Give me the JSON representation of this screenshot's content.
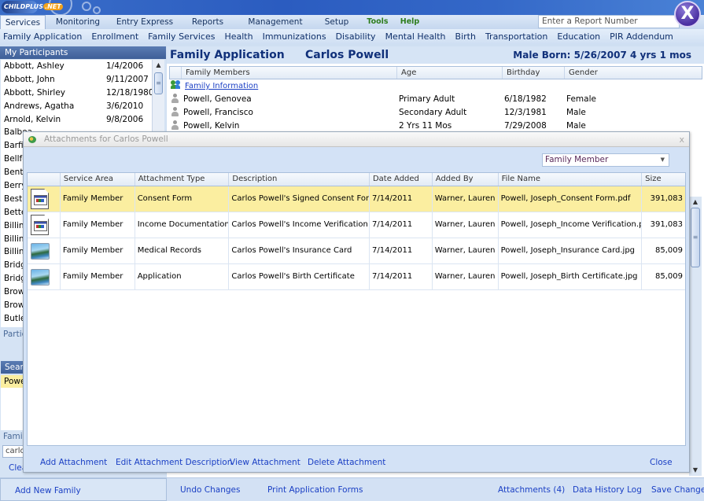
{
  "app": {
    "logo_text": "CHILDPLUS",
    "logo_badge": ".NET",
    "close_label": "X"
  },
  "main_menu": [
    {
      "label": "Services",
      "active": true
    },
    {
      "label": "Monitoring"
    },
    {
      "label": "Entry Express"
    },
    {
      "label": "Reports"
    },
    {
      "label": "Management"
    },
    {
      "label": "Setup"
    },
    {
      "label": "Tools",
      "style": "green"
    },
    {
      "label": "Help",
      "style": "green"
    }
  ],
  "report_search": {
    "placeholder": "Enter a Report Number"
  },
  "sub_menu": [
    "Family Application",
    "Enrollment",
    "Family Services",
    "Health",
    "Immunizations",
    "Disability",
    "Mental Health",
    "Birth",
    "Transportation",
    "Education",
    "PIR Addendum"
  ],
  "left_panel": {
    "title": "My Participants",
    "participants": [
      {
        "name": "Abbott, Ashley",
        "date": "1/4/2006"
      },
      {
        "name": "Abbott, John",
        "date": "9/11/2007"
      },
      {
        "name": "Abbott, Shirley",
        "date": "12/18/1980"
      },
      {
        "name": "Andrews, Agatha",
        "date": "3/6/2010"
      },
      {
        "name": "Arnold, Kelvin",
        "date": "9/8/2006"
      },
      {
        "name": "Balboa",
        "date": ""
      },
      {
        "name": "Barfield",
        "date": ""
      },
      {
        "name": "Bellford",
        "date": ""
      },
      {
        "name": "Bentley",
        "date": ""
      },
      {
        "name": "Berry,",
        "date": ""
      },
      {
        "name": "Best,",
        "date": ""
      },
      {
        "name": "Better",
        "date": ""
      },
      {
        "name": "Billings",
        "date": ""
      },
      {
        "name": "Billings",
        "date": ""
      },
      {
        "name": "Billings",
        "date": ""
      },
      {
        "name": "Bridge",
        "date": ""
      },
      {
        "name": "Bridge",
        "date": ""
      },
      {
        "name": "Brown",
        "date": ""
      },
      {
        "name": "Brown",
        "date": ""
      },
      {
        "name": "Butler",
        "date": ""
      }
    ],
    "participants_label": "Partic",
    "search_title": "Search",
    "search_result": "Powell",
    "family_label": "Family",
    "family_input_value": "carlos",
    "clear_label": "Clear"
  },
  "content": {
    "section_title": "Family Application",
    "child_name": "Carlos Powell",
    "child_info": "Male  Born: 5/26/2007  4 yrs 1 mos",
    "family_grid": {
      "columns": [
        "Family Members",
        "Age",
        "Birthday",
        "Gender"
      ],
      "family_info_link": "Family Information",
      "rows": [
        {
          "name": "Powell, Genovea",
          "age": "Primary Adult",
          "birthday": "6/18/1982",
          "gender": "Female"
        },
        {
          "name": "Powell, Francisco",
          "age": "Secondary Adult",
          "birthday": "12/3/1981",
          "gender": "Male"
        },
        {
          "name": "Powell, Kelvin",
          "age": "2 Yrs 11 Mos",
          "birthday": "7/29/2008",
          "gender": "Male"
        }
      ]
    }
  },
  "dialog": {
    "title": "Attachments for Carlos Powell",
    "close_label": "x",
    "filter_value": "Family Member",
    "columns": [
      "",
      "Service Area",
      "Attachment Type",
      "Description",
      "Date Added",
      "Added By",
      "File Name",
      "Size"
    ],
    "rows": [
      {
        "icon": "document",
        "service_area": "Family Member",
        "type": "Consent Form",
        "description": "Carlos Powell's Signed Consent Form",
        "date": "7/14/2011",
        "added_by": "Warner, Lauren",
        "file": "Powell, Joseph_Consent Form.pdf",
        "size": "391,083",
        "selected": true
      },
      {
        "icon": "document",
        "service_area": "Family Member",
        "type": "Income Documentation",
        "description": "Carlos Powell's Income Verification",
        "date": "7/14/2011",
        "added_by": "Warner, Lauren",
        "file": "Powell, Joseph_Income Verification.pdf",
        "size": "391,083"
      },
      {
        "icon": "image",
        "service_area": "Family Member",
        "type": "Medical Records",
        "description": "Carlos Powell's Insurance Card",
        "date": "7/14/2011",
        "added_by": "Warner, Lauren",
        "file": "Powell, Joseph_Insurance Card.jpg",
        "size": "85,009"
      },
      {
        "icon": "image",
        "service_area": "Family Member",
        "type": "Application",
        "description": "Carlos Powell's Birth Certificate",
        "date": "7/14/2011",
        "added_by": "Warner, Lauren",
        "file": "Powell, Joseph_Birth Certificate.jpg",
        "size": "85,009"
      }
    ],
    "actions": {
      "add": "Add Attachment",
      "edit": "Edit Attachment Description",
      "view": "View Attachment",
      "delete": "Delete Attachment",
      "close": "Close"
    }
  },
  "bottom_bar": {
    "add_new_family": "Add New Family",
    "undo": "Undo Changes",
    "print": "Print Application Forms",
    "attachments": "Attachments (4)",
    "history": "Data History Log",
    "save": "Save Changes"
  }
}
